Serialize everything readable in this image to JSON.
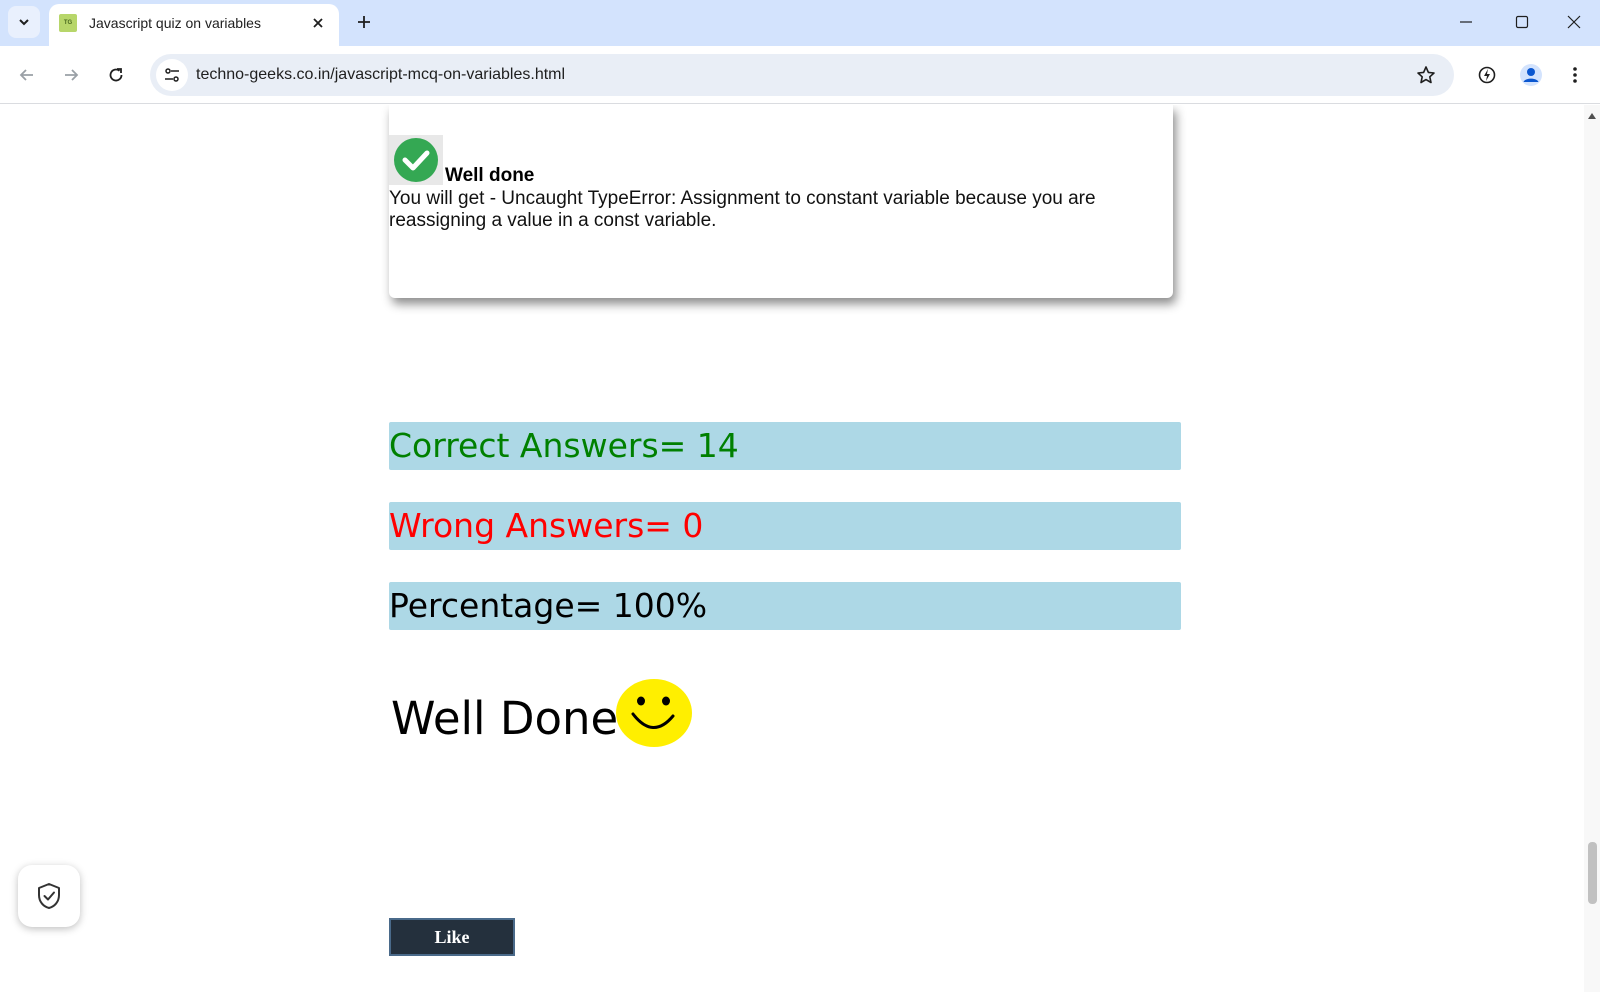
{
  "browser": {
    "tab_title": "Javascript quiz on variables",
    "favicon_text": "TG",
    "url": "techno-geeks.co.in/javascript-mcq-on-variables.html"
  },
  "answer_card": {
    "status": "Well done",
    "explanation": "You will get - Uncaught TypeError: Assignment to constant variable because you are reassigning a value in a const variable."
  },
  "results": {
    "correct": "Correct Answers= 14",
    "wrong": "Wrong Answers= 0",
    "percentage": "Percentage= 100%"
  },
  "verdict": "Well Done",
  "like_label": "Like",
  "colors": {
    "correct": "#008000",
    "wrong": "#ff0000",
    "result_bg": "#add8e6",
    "tabstrip": "#d3e3fd"
  }
}
